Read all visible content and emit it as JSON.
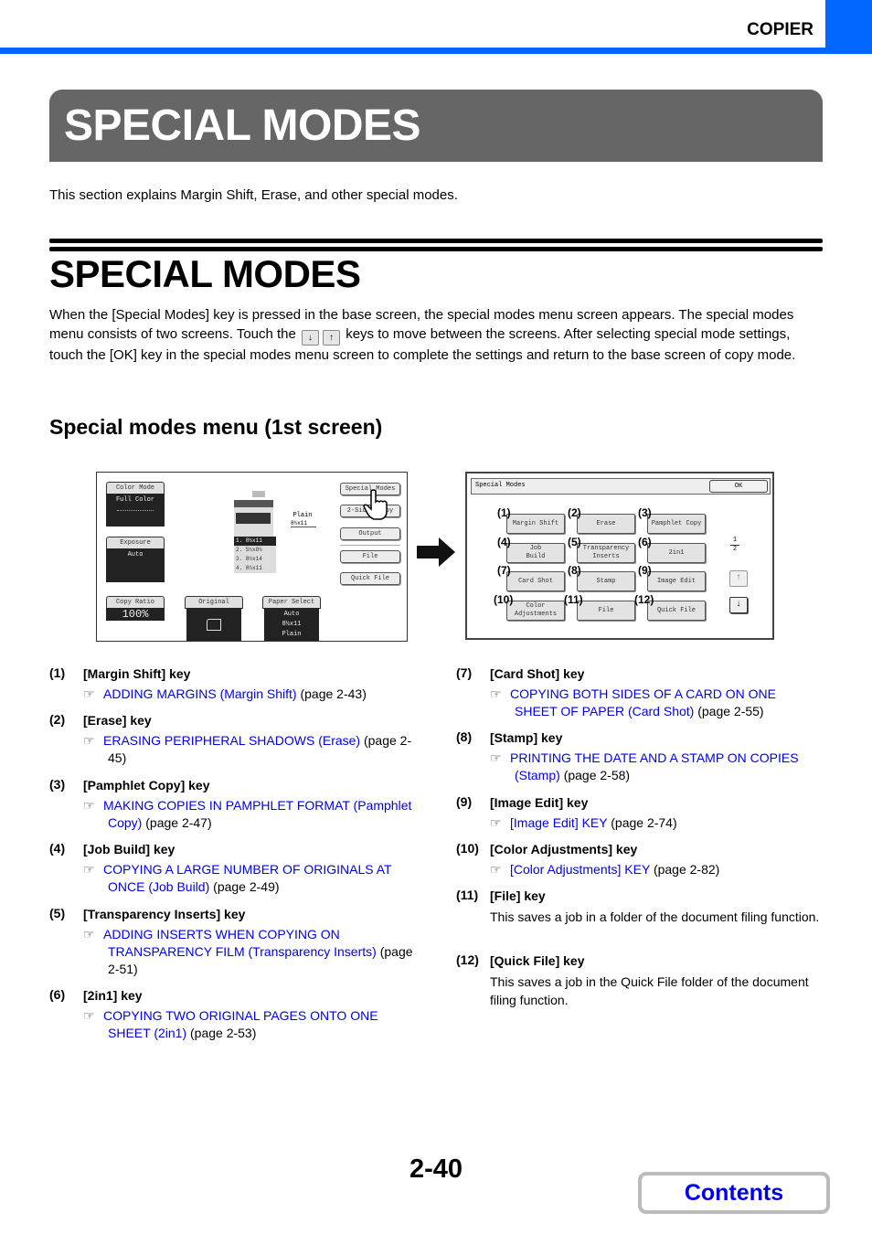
{
  "header": {
    "section": "COPIER",
    "accent_color": "#0066ff"
  },
  "banner": {
    "title": "SPECIAL MODES"
  },
  "intro": "This section explains Margin Shift, Erase, and other special modes.",
  "heading": "SPECIAL MODES",
  "paragraph": {
    "part1": "When the [Special Modes] key is pressed in the base screen, the special modes menu screen appears. The special modes menu consists of two screens. Touch the",
    "key_down": "↓",
    "key_up": "↑",
    "part2": "keys to move between the screens. After selecting special mode settings, touch the [OK] key in the special modes menu screen to complete the settings and return to the base screen of copy mode."
  },
  "subheading": "Special modes menu (1st screen)",
  "base_screen": {
    "color_mode": {
      "label": "Color Mode",
      "value": "Full Color"
    },
    "exposure": {
      "label": "Exposure",
      "value": "Auto"
    },
    "copy_ratio": {
      "label": "Copy Ratio",
      "value": "100%"
    },
    "original": {
      "label": "Original"
    },
    "paper_select": {
      "label": "Paper Select",
      "line1": "Auto",
      "line2": "8½x11",
      "line3": "Plain"
    },
    "tray_info": {
      "type": "Plain",
      "size": "8½x11"
    },
    "trays": [
      "1. 8½x11",
      "2. 5½x8½",
      "3. 8½x14",
      "4. 8½x11"
    ],
    "right_keys": [
      "Special Modes",
      "2-Sided Copy",
      "Output",
      "File",
      "Quick File"
    ]
  },
  "menu_screen": {
    "title": "Special Modes",
    "ok": "OK",
    "page_current": "1",
    "page_total": "2",
    "up": "↑",
    "down": "↓",
    "keys": [
      {
        "callout": "(1)",
        "label": "Margin Shift"
      },
      {
        "callout": "(2)",
        "label": "Erase"
      },
      {
        "callout": "(3)",
        "label": "Pamphlet Copy"
      },
      {
        "callout": "(4)",
        "label": "Job\nBuild"
      },
      {
        "callout": "(5)",
        "label": "Transparency\nInserts"
      },
      {
        "callout": "(6)",
        "label": "2in1"
      },
      {
        "callout": "(7)",
        "label": "Card Shot"
      },
      {
        "callout": "(8)",
        "label": "Stamp"
      },
      {
        "callout": "(9)",
        "label": "Image Edit"
      },
      {
        "callout": "(10)",
        "label": "Color\nAdjustments"
      },
      {
        "callout": "(11)",
        "label": "File"
      },
      {
        "callout": "(12)",
        "label": "Quick File"
      }
    ]
  },
  "items": [
    {
      "num": "(1)",
      "title": "[Margin Shift] key",
      "link": "ADDING MARGINS (Margin Shift)",
      "page": "(page 2-43)"
    },
    {
      "num": "(2)",
      "title": "[Erase] key",
      "link": "ERASING PERIPHERAL SHADOWS (Erase)",
      "page": "(page 2-45)"
    },
    {
      "num": "(3)",
      "title": "[Pamphlet Copy] key",
      "link": "MAKING COPIES IN PAMPHLET FORMAT (Pamphlet Copy)",
      "page": "(page 2-47)"
    },
    {
      "num": "(4)",
      "title": "[Job Build] key",
      "link": "COPYING A LARGE NUMBER OF ORIGINALS AT ONCE (Job Build)",
      "page": "(page 2-49)"
    },
    {
      "num": "(5)",
      "title": "[Transparency Inserts] key",
      "link": "ADDING INSERTS WHEN COPYING ON TRANSPARENCY FILM (Transparency Inserts)",
      "page": "(page 2-51)"
    },
    {
      "num": "(6)",
      "title": "[2in1] key",
      "link": "COPYING TWO ORIGINAL PAGES ONTO ONE SHEET (2in1)",
      "page": "(page 2-53)"
    },
    {
      "num": "(7)",
      "title": "[Card Shot] key",
      "link": "COPYING BOTH SIDES OF A CARD ON ONE SHEET OF PAPER (Card Shot)",
      "page": "(page 2-55)"
    },
    {
      "num": "(8)",
      "title": "[Stamp] key",
      "link": "PRINTING THE DATE AND A STAMP ON COPIES (Stamp)",
      "page": "(page 2-58)"
    },
    {
      "num": "(9)",
      "title": "[Image Edit] key",
      "link": "[Image Edit] KEY",
      "page": "(page 2-74)"
    },
    {
      "num": "(10)",
      "title": "[Color Adjustments] key",
      "link": "[Color Adjustments] KEY",
      "page": "(page 2-82)"
    },
    {
      "num": "(11)",
      "title": "[File] key",
      "desc": "This saves a job in a folder of the document filing function."
    },
    {
      "num": "(12)",
      "title": "[Quick File] key",
      "desc": "This saves a job in the Quick File folder of the document filing function."
    }
  ],
  "footer": {
    "page": "2-40",
    "contents": "Contents",
    "link_color": "#0000ee"
  }
}
